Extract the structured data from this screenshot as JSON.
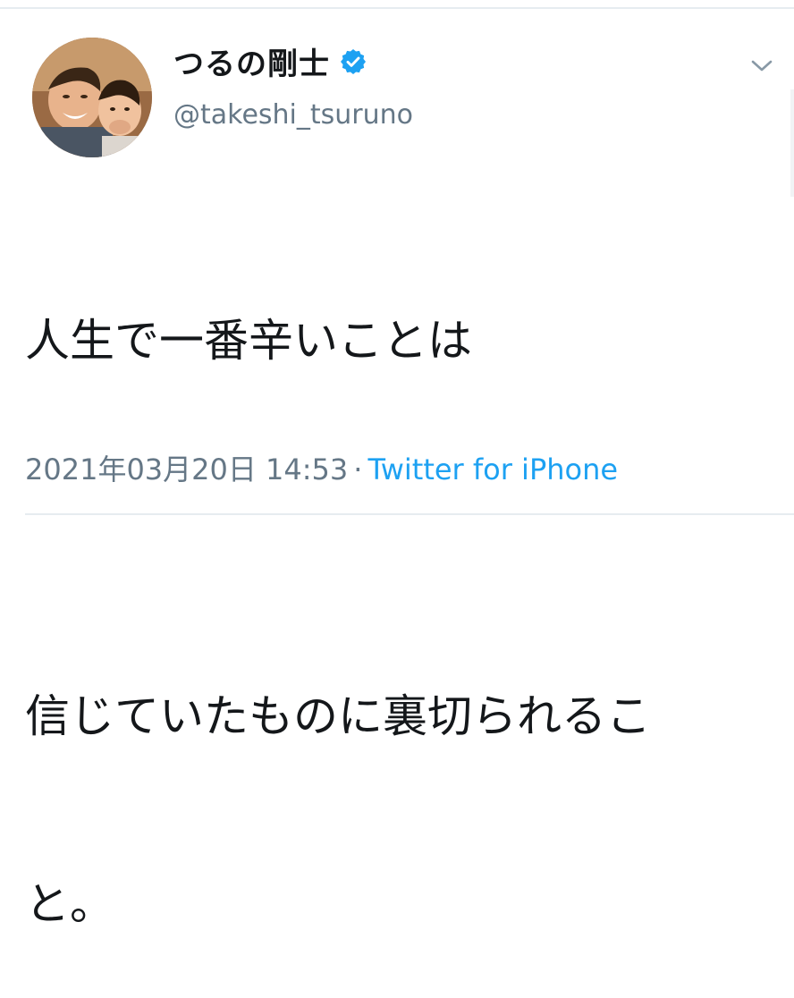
{
  "tweet": {
    "author": {
      "display_name": "つるの剛士",
      "handle": "@takeshi_tsuruno",
      "verified": true,
      "avatar_icon": "user-avatar-photo"
    },
    "text_lines": [
      "人生で一番辛いことは",
      "",
      "信じていたものに裏切られるこ",
      "と。"
    ],
    "timestamp": "2021年03月20日 14:53",
    "separator": "·",
    "source": "Twitter for iPhone"
  },
  "icons": {
    "verified": "verified-badge-icon",
    "more": "chevron-down-icon"
  },
  "colors": {
    "verified_blue": "#1da1f2",
    "link_blue": "#1da1f2",
    "secondary_text": "#657786",
    "primary_text": "#14171a"
  }
}
